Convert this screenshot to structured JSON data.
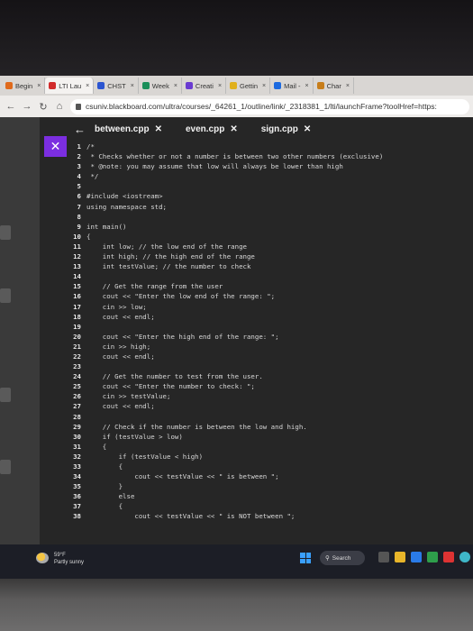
{
  "tabs": [
    {
      "label": "Begin",
      "color": "#e06a1c"
    },
    {
      "label": "LTI Lau",
      "color": "#d12b2b",
      "active": true
    },
    {
      "label": "CHST",
      "color": "#2b55d1"
    },
    {
      "label": "Week",
      "color": "#1a8f5a"
    },
    {
      "label": "Creati",
      "color": "#6a3bd1"
    },
    {
      "label": "Gettin",
      "color": "#e0b01c"
    },
    {
      "label": "Mail -",
      "color": "#1c6ae0"
    },
    {
      "label": "Char",
      "color": "#c77d1a"
    }
  ],
  "url": "csuniv.blackboard.com/ultra/courses/_64261_1/outline/link/_2318381_1/lti/launchFrame?toolHref=https:",
  "editor": {
    "files": [
      "between.cpp",
      "even.cpp",
      "sign.cpp"
    ],
    "close_glyph": "✕",
    "code": [
      {
        "n": "1",
        "t": "/*"
      },
      {
        "n": "2",
        "t": " * Checks whether or not a number is between two other numbers (exclusive)"
      },
      {
        "n": "3",
        "t": " * @note: you may assume that low will always be lower than high"
      },
      {
        "n": "4",
        "t": " */"
      },
      {
        "n": "5",
        "t": ""
      },
      {
        "n": "6",
        "t": "#include <iostream>"
      },
      {
        "n": "7",
        "t": "using namespace std;"
      },
      {
        "n": "8",
        "t": ""
      },
      {
        "n": "9",
        "t": "int main()"
      },
      {
        "n": "10",
        "t": "{"
      },
      {
        "n": "11",
        "t": "    int low; // the low end of the range"
      },
      {
        "n": "12",
        "t": "    int high; // the high end of the range"
      },
      {
        "n": "13",
        "t": "    int testValue; // the number to check"
      },
      {
        "n": "14",
        "t": ""
      },
      {
        "n": "15",
        "t": "    // Get the range from the user"
      },
      {
        "n": "16",
        "t": "    cout << \"Enter the low end of the range: \";"
      },
      {
        "n": "17",
        "t": "    cin >> low;"
      },
      {
        "n": "18",
        "t": "    cout << endl;"
      },
      {
        "n": "19",
        "t": ""
      },
      {
        "n": "20",
        "t": "    cout << \"Enter the high end of the range: \";"
      },
      {
        "n": "21",
        "t": "    cin >> high;"
      },
      {
        "n": "22",
        "t": "    cout << endl;"
      },
      {
        "n": "23",
        "t": ""
      },
      {
        "n": "24",
        "t": "    // Get the number to test from the user."
      },
      {
        "n": "25",
        "t": "    cout << \"Enter the number to check: \";"
      },
      {
        "n": "26",
        "t": "    cin >> testValue;"
      },
      {
        "n": "27",
        "t": "    cout << endl;"
      },
      {
        "n": "28",
        "t": ""
      },
      {
        "n": "29",
        "t": "    // Check if the number is between the low and high."
      },
      {
        "n": "30",
        "t": "    if (testValue > low)"
      },
      {
        "n": "31",
        "t": "    {"
      },
      {
        "n": "32",
        "t": "        if (testValue < high)"
      },
      {
        "n": "33",
        "t": "        {"
      },
      {
        "n": "34",
        "t": "            cout << testValue << \" is between \";"
      },
      {
        "n": "35",
        "t": "        }"
      },
      {
        "n": "36",
        "t": "        else"
      },
      {
        "n": "37",
        "t": "        {"
      },
      {
        "n": "38",
        "t": "            cout << testValue << \" is NOT between \";"
      }
    ]
  },
  "taskbar": {
    "weather_temp": "59°F",
    "weather_desc": "Partly sunny",
    "search_label": "Search"
  }
}
